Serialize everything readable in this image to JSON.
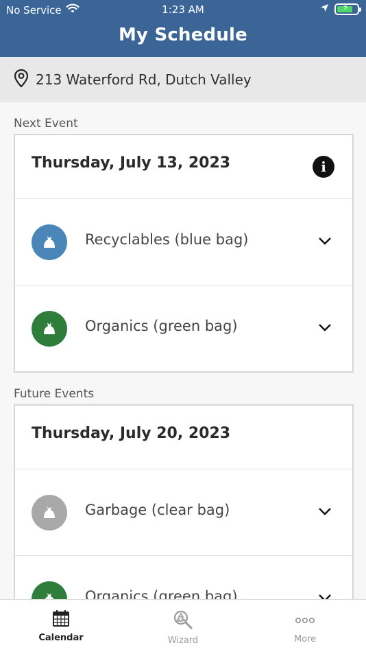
{
  "status_bar": {
    "carrier": "No Service",
    "time": "1:23 AM",
    "wifi_icon": "wifi-icon",
    "location_icon": "location-arrow-icon",
    "battery_icon": "battery-charging-icon"
  },
  "header": {
    "title": "My Schedule",
    "background": "#3a6596"
  },
  "address": {
    "text": "213 Waterford Rd, Dutch Valley",
    "icon": "map-pin-icon"
  },
  "next_event": {
    "label": "Next Event",
    "date": "Thursday, July 13, 2023",
    "info_icon": "info-icon",
    "items": [
      {
        "label": "Recyclables (blue bag)",
        "color": "#4a86b8",
        "icon": "bag-icon"
      },
      {
        "label": "Organics (green bag)",
        "color": "#2e7d3b",
        "icon": "bag-icon"
      }
    ]
  },
  "future_events": {
    "label": "Future Events",
    "date": "Thursday, July 20, 2023",
    "items": [
      {
        "label": "Garbage (clear bag)",
        "color": "#a8a8a8",
        "icon": "bag-icon"
      },
      {
        "label": "Organics (green bag)",
        "color": "#2e7d3b",
        "icon": "bag-icon"
      }
    ]
  },
  "bottom_nav": [
    {
      "label": "Calendar",
      "icon": "calendar-icon",
      "active": true
    },
    {
      "label": "Wizard",
      "icon": "recycle-search-icon",
      "active": false
    },
    {
      "label": "More",
      "icon": "more-dots-icon",
      "active": false
    }
  ]
}
